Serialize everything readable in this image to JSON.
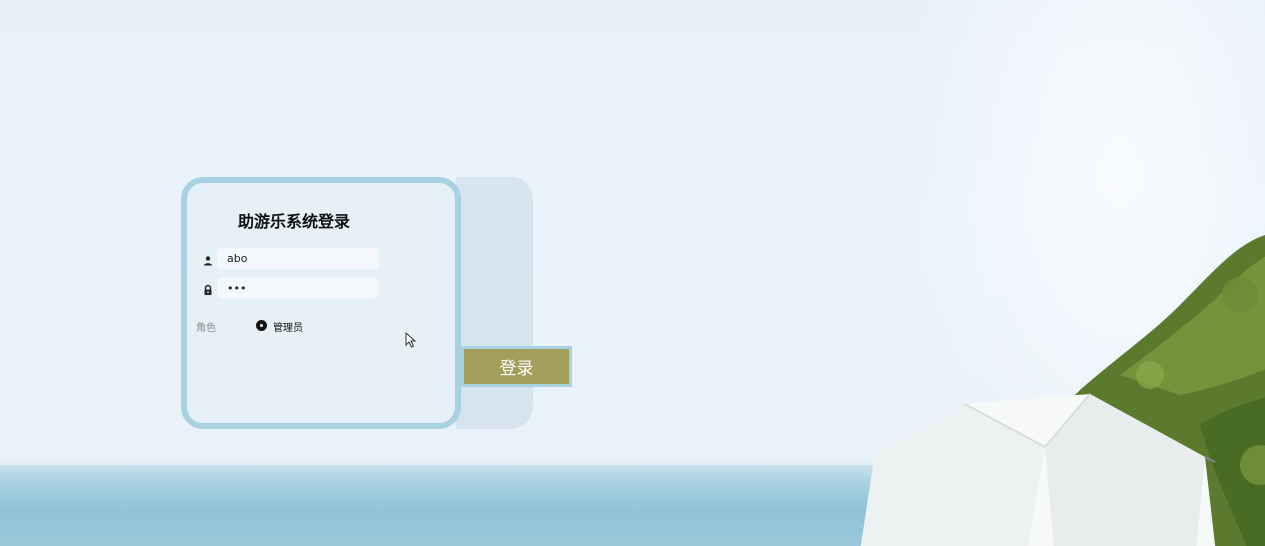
{
  "login": {
    "title": "助游乐系统登录",
    "username": {
      "value": "abo",
      "icon": "user-icon"
    },
    "password": {
      "value": "•••",
      "icon": "lock-icon"
    },
    "role": {
      "label": "角色",
      "options": [
        {
          "label": "管理员",
          "selected": true
        }
      ]
    },
    "submit_label": "登录"
  },
  "colors": {
    "card_border": "#a8d1e1",
    "card_bg": "#e6f0f8",
    "button_bg": "#a39e5b",
    "button_text": "#ffffff"
  }
}
